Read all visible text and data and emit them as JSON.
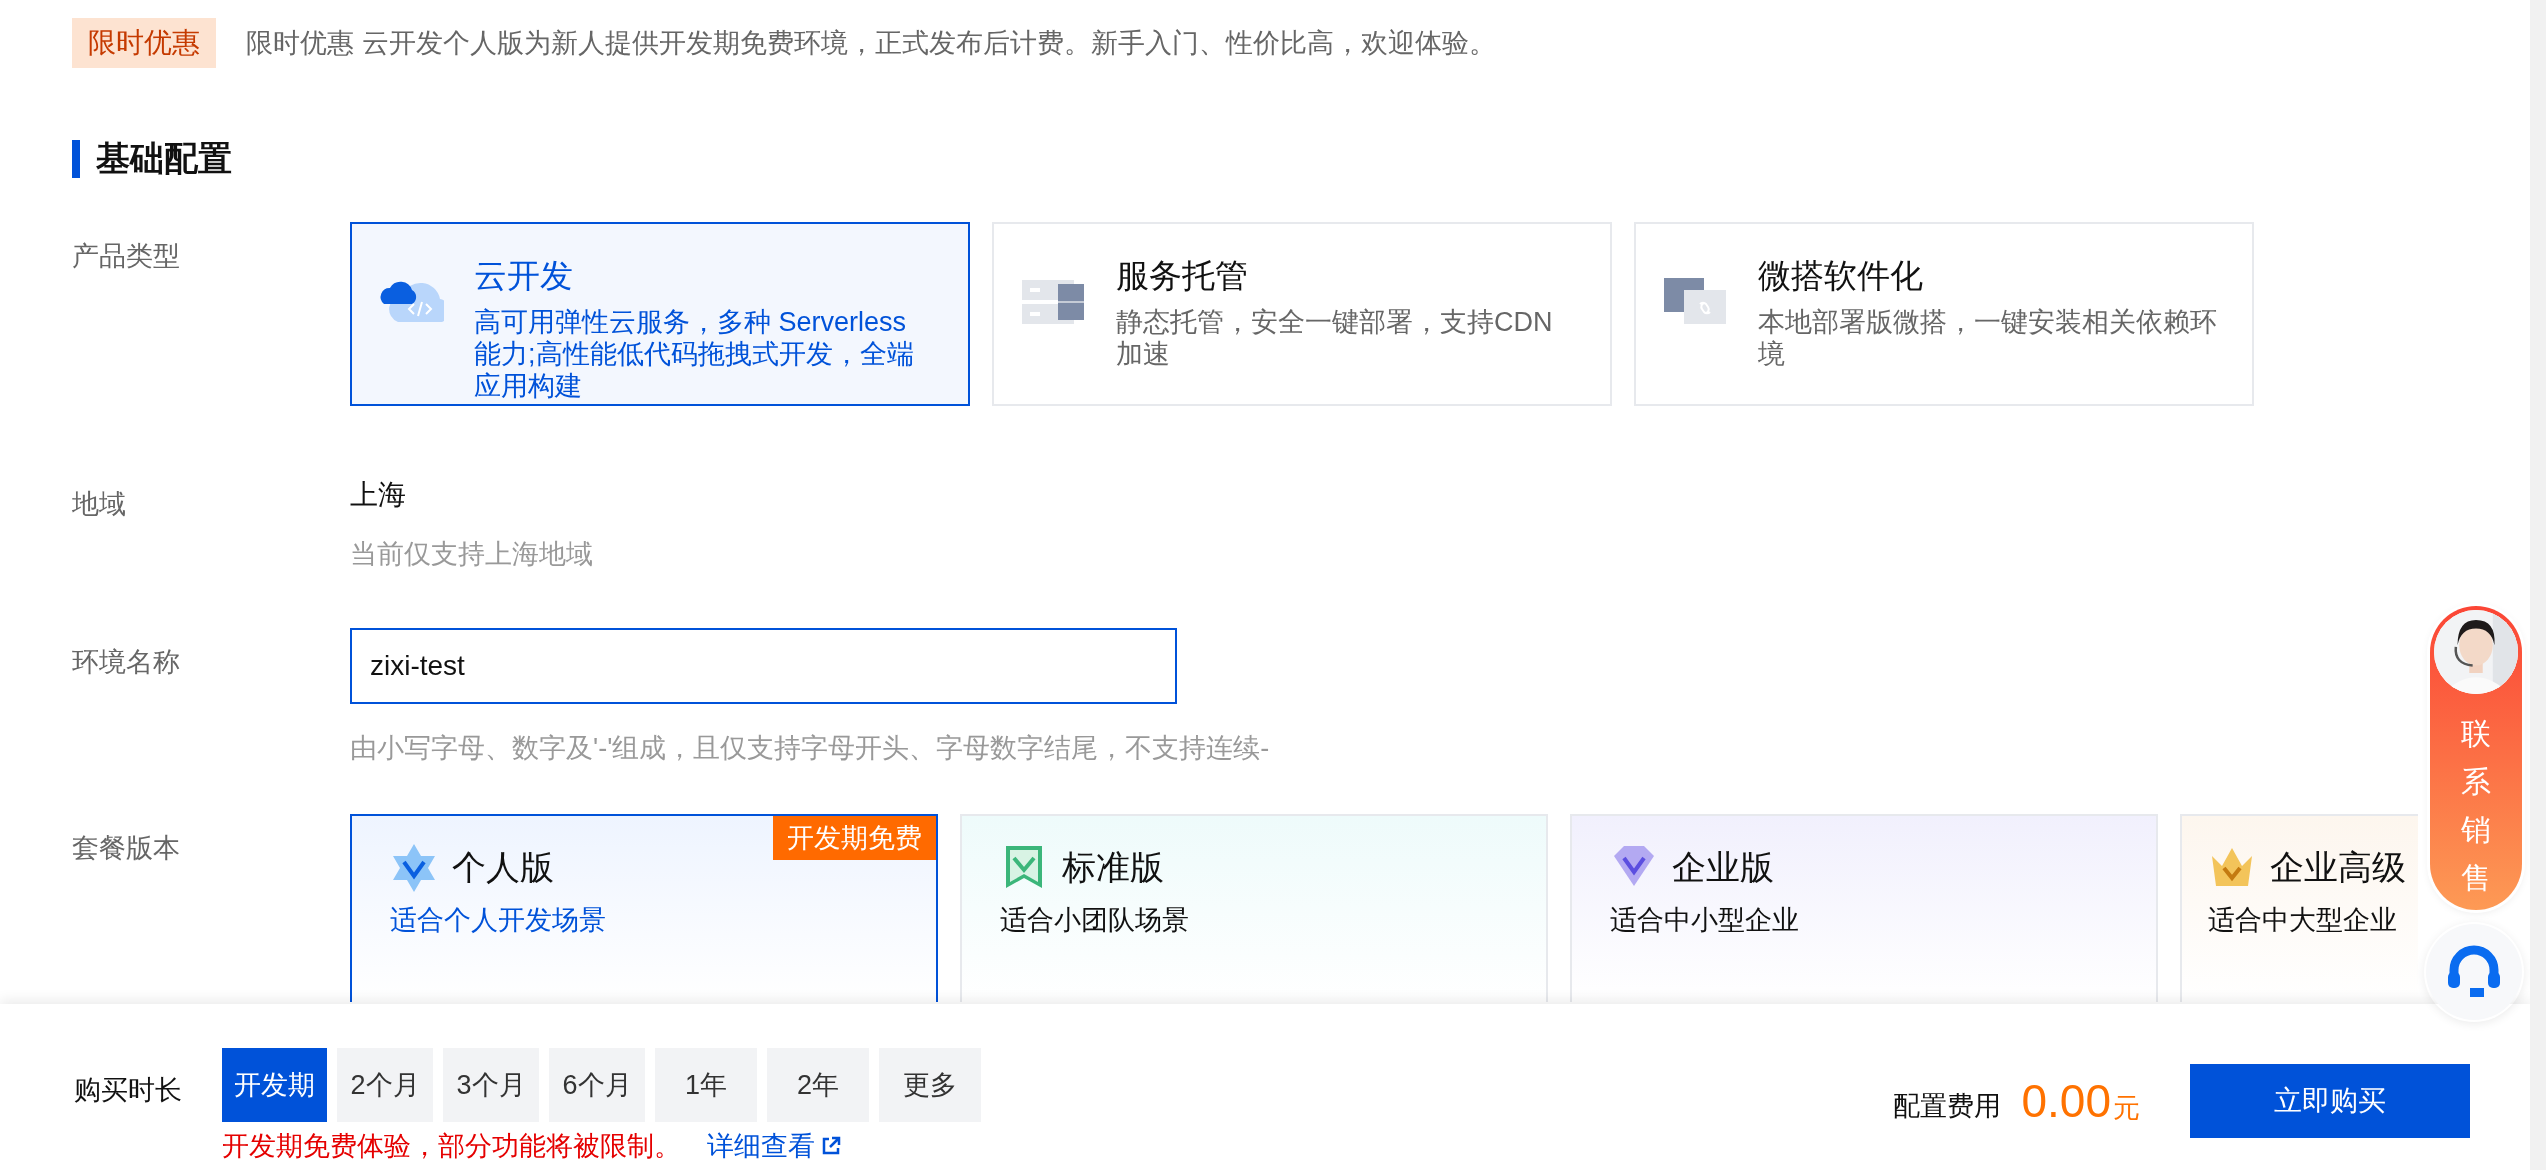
{
  "promo": {
    "tag": "限时优惠",
    "text": "限时优惠 云开发个人版为新人提供开发期免费环境，正式发布后计费。新手入门、性价比高，欢迎体验。"
  },
  "section_title": "基础配置",
  "product_type": {
    "label": "产品类型",
    "options": [
      {
        "title": "云开发",
        "description": "高可用弹性云服务，多种 Serverless 能力;高性能低代码拖拽式开发，全端应用构建",
        "selected": true
      },
      {
        "title": "服务托管",
        "description": "静态托管，安全一键部署，支持CDN加速",
        "selected": false
      },
      {
        "title": "微搭软件化",
        "description": "本地部署版微搭，一键安装相关依赖环境",
        "selected": false
      }
    ]
  },
  "region": {
    "label": "地域",
    "value": "上海",
    "hint": "当前仅支持上海地域"
  },
  "env_name": {
    "label": "环境名称",
    "value": "zixi-test",
    "hint": "由小写字母、数字及'-'组成，且仅支持字母开头、字母数字结尾，不支持连续-"
  },
  "plan": {
    "label": "套餐版本",
    "items": [
      {
        "title": "个人版",
        "subtitle": "适合个人开发场景",
        "selected": true,
        "badge": "开发期免费"
      },
      {
        "title": "标准版",
        "subtitle": "适合小团队场景",
        "selected": false
      },
      {
        "title": "企业版",
        "subtitle": "适合中小型企业",
        "selected": false
      },
      {
        "title": "企业高级",
        "subtitle": "适合中大型企业",
        "selected": false
      }
    ]
  },
  "duration": {
    "label": "购买时长",
    "options": [
      {
        "label": "开发期",
        "selected": true
      },
      {
        "label": "2个月",
        "selected": false
      },
      {
        "label": "3个月",
        "selected": false
      },
      {
        "label": "6个月",
        "selected": false
      },
      {
        "label": "1年",
        "selected": false
      },
      {
        "label": "2年",
        "selected": false
      },
      {
        "label": "更多",
        "selected": false
      }
    ],
    "note": "开发期免费体验，部分功能将被限制。",
    "link": "详细查看"
  },
  "cost": {
    "label": "配置费用",
    "amount": "0.00",
    "unit": "元"
  },
  "buy_button": "立即购买",
  "contact": {
    "text": "联系销售"
  }
}
